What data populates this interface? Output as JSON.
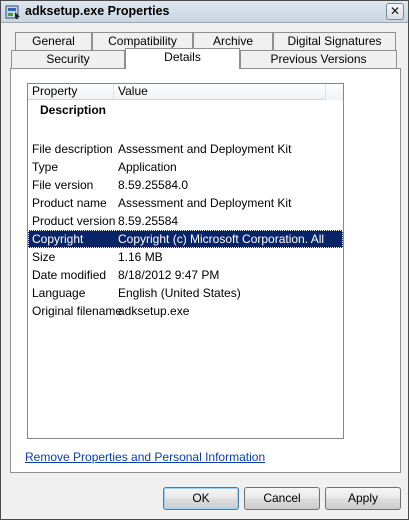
{
  "window": {
    "title": "adksetup.exe Properties",
    "close_glyph": "✕",
    "icon": "setup-exe-icon"
  },
  "tabs": {
    "row_back": [
      "General",
      "Compatibility",
      "Archive",
      "Digital Signatures"
    ],
    "row_front": [
      "Security",
      "Details",
      "Previous Versions"
    ],
    "active": "Details"
  },
  "listview": {
    "columns": [
      "Property",
      "Value"
    ],
    "group": "Description",
    "rows": [
      {
        "property": "File description",
        "value": "Assessment and Deployment Kit"
      },
      {
        "property": "Type",
        "value": "Application"
      },
      {
        "property": "File version",
        "value": "8.59.25584.0"
      },
      {
        "property": "Product name",
        "value": "Assessment and Deployment Kit"
      },
      {
        "property": "Product version",
        "value": "8.59.25584"
      },
      {
        "property": "Copyright",
        "value": "Copyright (c) Microsoft Corporation. All ri..."
      },
      {
        "property": "Size",
        "value": "1.16 MB"
      },
      {
        "property": "Date modified",
        "value": "8/18/2012 9:47 PM"
      },
      {
        "property": "Language",
        "value": "English (United States)"
      },
      {
        "property": "Original filename",
        "value": "adksetup.exe"
      }
    ],
    "selected_property": "Copyright"
  },
  "link": {
    "remove_properties": "Remove Properties and Personal Information"
  },
  "buttons": {
    "ok": "OK",
    "cancel": "Cancel",
    "apply": "Apply"
  },
  "colors": {
    "selection": "#0a246a",
    "link": "#0b3ea8"
  }
}
